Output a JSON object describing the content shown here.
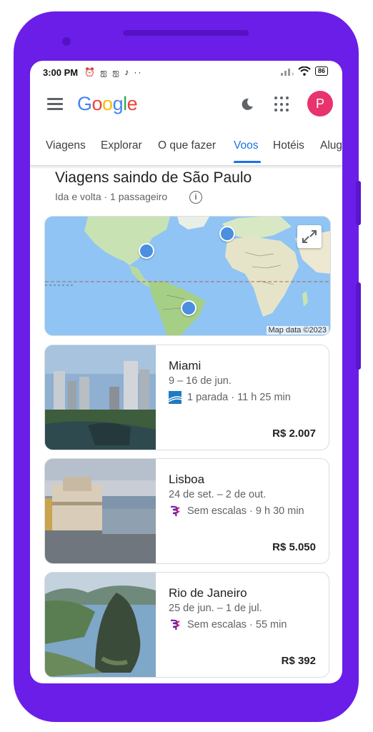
{
  "status_bar": {
    "time": "3:00 PM",
    "icons": "⏰ ஐ ஐ ♪ ··",
    "battery": "86"
  },
  "header": {
    "logo": "Google",
    "avatar_letter": "P",
    "colors": {
      "blue": "#4285f4",
      "red": "#ea4335",
      "yellow": "#fbbc05",
      "green": "#34a853",
      "avatar": "#e8336d"
    }
  },
  "tabs": [
    {
      "label": "Viagens",
      "active": false
    },
    {
      "label": "Explorar",
      "active": false
    },
    {
      "label": "O que fazer",
      "active": false
    },
    {
      "label": "Voos",
      "active": true
    },
    {
      "label": "Hotéis",
      "active": false
    },
    {
      "label": "Alug",
      "active": false
    }
  ],
  "main": {
    "title": "Viagens saindo de São Paulo",
    "subtitle": "Ida e volta · 1 passageiro",
    "map_credit": "Map data ©2023"
  },
  "cards": [
    {
      "city": "Miami",
      "dates": "9 – 16 de jun.",
      "flight": "1 parada · 11 h 25 min",
      "price": "R$ 2.007",
      "airline_icon": "airline-stripes-icon"
    },
    {
      "city": "Lisboa",
      "dates": "24 de set. – 2 de out.",
      "flight": "Sem escalas · 9 h 30 min",
      "price": "R$ 5.050",
      "airline_icon": "latam-icon"
    },
    {
      "city": "Rio de Janeiro",
      "dates": "25 de jun. – 1 de jul.",
      "flight": "Sem escalas · 55 min",
      "price": "R$ 392",
      "airline_icon": "latam-icon"
    }
  ]
}
